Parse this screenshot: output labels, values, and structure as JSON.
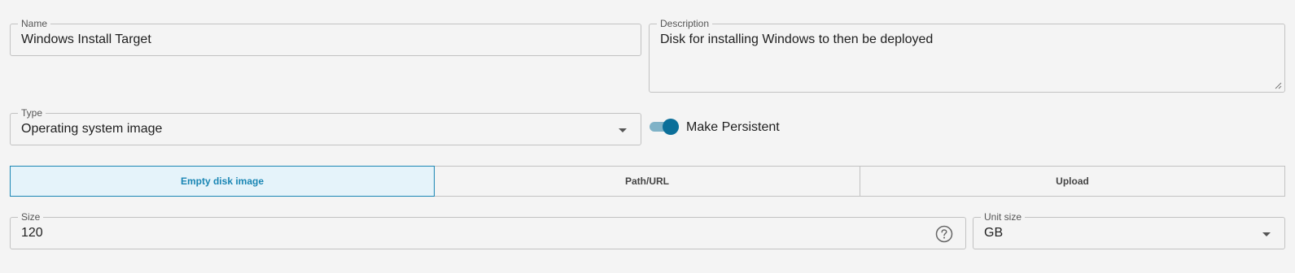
{
  "form": {
    "name": {
      "label": "Name",
      "value": "Windows Install Target"
    },
    "description": {
      "label": "Description",
      "value": "Disk for installing Windows to then be deployed"
    },
    "type": {
      "label": "Type",
      "value": "Operating system image"
    },
    "persistent": {
      "label": "Make Persistent",
      "on": true
    },
    "source_tabs": [
      {
        "label": "Empty disk image",
        "active": true
      },
      {
        "label": "Path/URL",
        "active": false
      },
      {
        "label": "Upload",
        "active": false
      }
    ],
    "size": {
      "label": "Size",
      "value": "120"
    },
    "unit_size": {
      "label": "Unit size",
      "value": "GB"
    }
  },
  "colors": {
    "accent": "#1a86b4",
    "toggle_thumb": "#0b6f99",
    "toggle_track": "#7fb2c7",
    "active_tab_bg": "#e5f3fa",
    "background": "#f4f4f4",
    "border": "#c2c2c2"
  },
  "icons": {
    "help": "question-circle-icon",
    "dropdown": "caret-down-icon",
    "resize": "resize-handle-icon"
  }
}
